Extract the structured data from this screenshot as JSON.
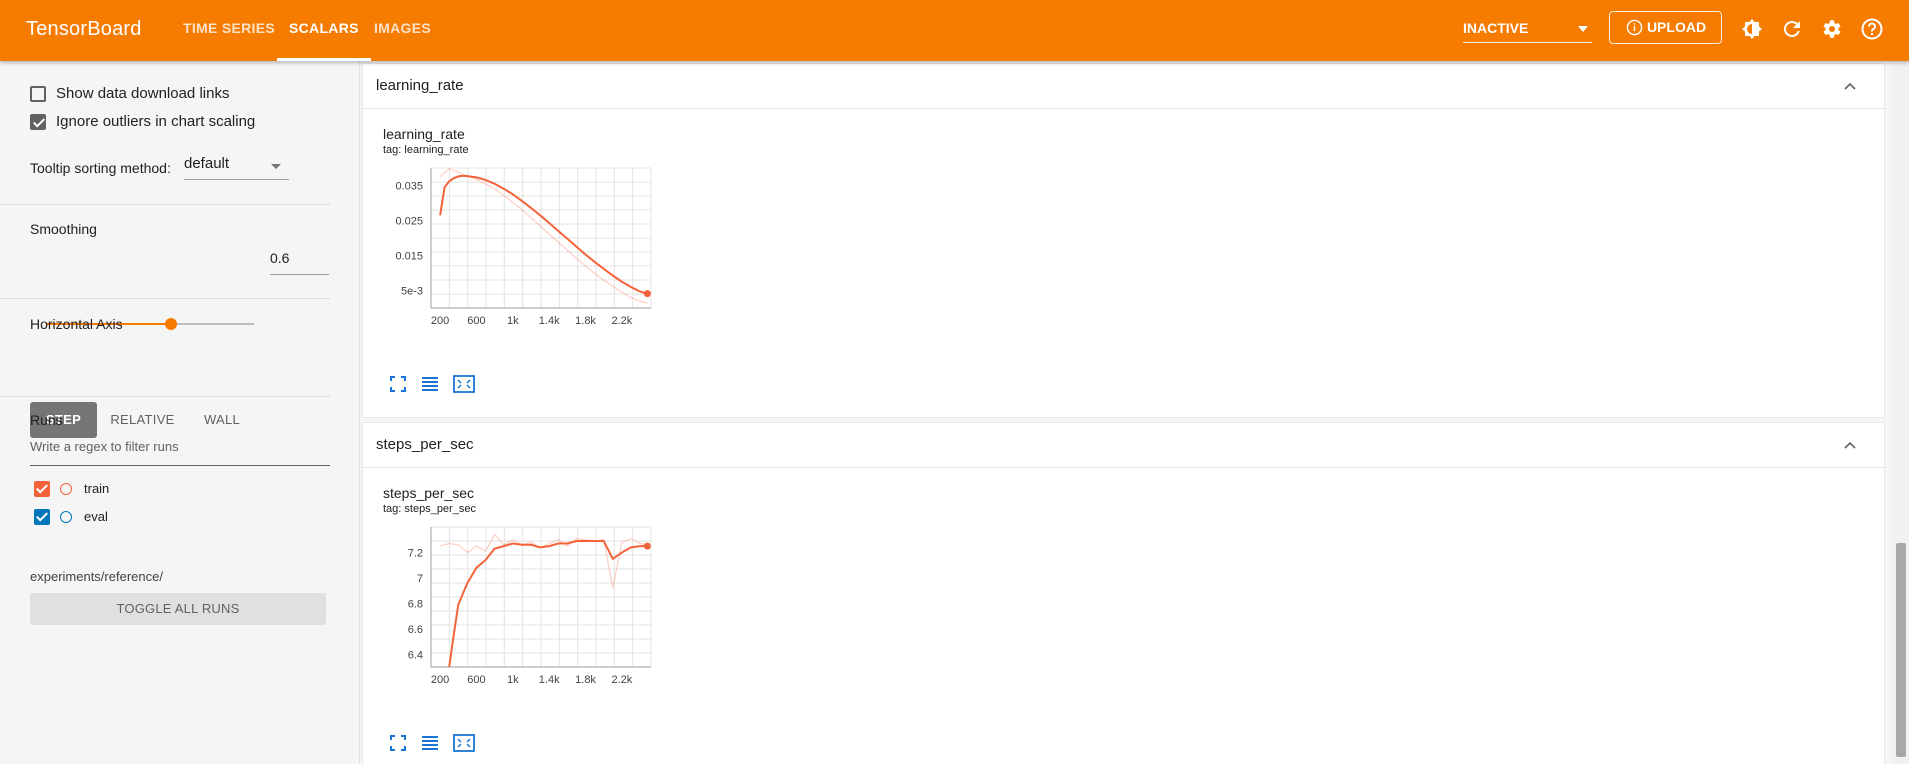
{
  "app": {
    "title": "TensorBoard",
    "tabs": [
      {
        "label": "TIME SERIES",
        "active": false
      },
      {
        "label": "SCALARS",
        "active": true
      },
      {
        "label": "IMAGES",
        "active": false
      }
    ],
    "run_status": "INACTIVE",
    "upload_label": "UPLOAD",
    "icons": [
      "brightness-icon",
      "refresh-icon",
      "settings-icon",
      "help-icon"
    ],
    "accent_color": "#f57c00"
  },
  "sidebar": {
    "show_download_links": {
      "label": "Show data download links",
      "checked": false
    },
    "ignore_outliers": {
      "label": "Ignore outliers in chart scaling",
      "checked": true
    },
    "tooltip_sorting": {
      "label": "Tooltip sorting method:",
      "value": "default"
    },
    "smoothing": {
      "label": "Smoothing",
      "value": "0.6",
      "fraction": 0.6
    },
    "horizontal_axis": {
      "label": "Horizontal Axis",
      "options": [
        {
          "label": "STEP",
          "active": true
        },
        {
          "label": "RELATIVE",
          "active": false
        },
        {
          "label": "WALL",
          "active": false
        }
      ]
    },
    "runs": {
      "label": "Runs",
      "filter_placeholder": "Write a regex to filter runs",
      "items": [
        {
          "label": "train",
          "checked": true,
          "color": "#f4623a"
        },
        {
          "label": "eval",
          "checked": true,
          "color": "#0077bb"
        }
      ],
      "toggle_label": "TOGGLE ALL RUNS",
      "path": "experiments/reference/"
    }
  },
  "cards": [
    {
      "group_title": "learning_rate",
      "chart_title": "learning_rate",
      "tag": "tag: learning_rate"
    },
    {
      "group_title": "steps_per_sec",
      "chart_title": "steps_per_sec",
      "tag": "tag: steps_per_sec"
    }
  ],
  "chart_data": [
    {
      "type": "line",
      "title": "learning_rate",
      "subtitle": "tag: learning_rate",
      "xlabel": "",
      "ylabel": "",
      "xlim": [
        100,
        2520
      ],
      "ylim": [
        0.0,
        0.04
      ],
      "x_ticks": [
        200,
        600,
        1000,
        1400,
        1800,
        2200
      ],
      "x_tick_labels": [
        "200",
        "600",
        "1k",
        "1.4k",
        "1.8k",
        "2.2k"
      ],
      "y_ticks": [
        0.005,
        0.015,
        0.025,
        0.035
      ],
      "y_tick_labels": [
        "5e-3",
        "0.015",
        "0.025",
        "0.035"
      ],
      "grid": true,
      "series": [
        {
          "name": "train",
          "color": "#f4623a",
          "raw": [
            [
              200,
              0.0375
            ],
            [
              300,
              0.0398
            ],
            [
              400,
              0.0388
            ],
            [
              500,
              0.0377
            ],
            [
              600,
              0.0367
            ],
            [
              700,
              0.0355
            ],
            [
              800,
              0.034
            ],
            [
              900,
              0.0322
            ],
            [
              1000,
              0.0302
            ],
            [
              1100,
              0.0281
            ],
            [
              1200,
              0.0258
            ],
            [
              1300,
              0.0235
            ],
            [
              1400,
              0.0211
            ],
            [
              1500,
              0.0188
            ],
            [
              1600,
              0.0165
            ],
            [
              1700,
              0.0142
            ],
            [
              1800,
              0.012
            ],
            [
              1900,
              0.0099
            ],
            [
              2000,
              0.008
            ],
            [
              2100,
              0.0062
            ],
            [
              2200,
              0.0045
            ],
            [
              2300,
              0.003
            ],
            [
              2400,
              0.0019
            ],
            [
              2480,
              0.0014
            ]
          ],
          "smoothed": [
            [
              200,
              0.0265
            ],
            [
              250,
              0.0345
            ],
            [
              300,
              0.0362
            ],
            [
              350,
              0.0371
            ],
            [
              400,
              0.0376
            ],
            [
              450,
              0.0378
            ],
            [
              500,
              0.0377
            ],
            [
              600,
              0.0373
            ],
            [
              700,
              0.0366
            ],
            [
              800,
              0.0355
            ],
            [
              900,
              0.0341
            ],
            [
              1000,
              0.0325
            ],
            [
              1100,
              0.0306
            ],
            [
              1200,
              0.0286
            ],
            [
              1300,
              0.0265
            ],
            [
              1400,
              0.0243
            ],
            [
              1500,
              0.022
            ],
            [
              1600,
              0.0198
            ],
            [
              1700,
              0.0175
            ],
            [
              1800,
              0.0153
            ],
            [
              1900,
              0.0132
            ],
            [
              2000,
              0.0112
            ],
            [
              2100,
              0.0093
            ],
            [
              2200,
              0.0075
            ],
            [
              2300,
              0.006
            ],
            [
              2400,
              0.0047
            ],
            [
              2480,
              0.0041
            ]
          ]
        }
      ]
    },
    {
      "type": "line",
      "title": "steps_per_sec",
      "subtitle": "tag: steps_per_sec",
      "xlabel": "",
      "ylabel": "",
      "xlim": [
        100,
        2520
      ],
      "ylim": [
        6.3,
        7.4
      ],
      "x_ticks": [
        200,
        600,
        1000,
        1400,
        1800,
        2200
      ],
      "x_tick_labels": [
        "200",
        "600",
        "1k",
        "1.4k",
        "1.8k",
        "2.2k"
      ],
      "y_ticks": [
        6.4,
        6.6,
        6.8,
        7.0,
        7.2
      ],
      "y_tick_labels": [
        "6.4",
        "6.6",
        "6.8",
        "7",
        "7.2"
      ],
      "grid": true,
      "series": [
        {
          "name": "train",
          "color": "#f4623a",
          "raw": [
            [
              200,
              7.25
            ],
            [
              300,
              7.27
            ],
            [
              400,
              7.26
            ],
            [
              500,
              7.2
            ],
            [
              600,
              7.25
            ],
            [
              700,
              7.21
            ],
            [
              800,
              7.34
            ],
            [
              900,
              7.26
            ],
            [
              1000,
              7.3
            ],
            [
              1100,
              7.26
            ],
            [
              1200,
              7.28
            ],
            [
              1300,
              7.24
            ],
            [
              1400,
              7.27
            ],
            [
              1500,
              7.3
            ],
            [
              1600,
              7.25
            ],
            [
              1700,
              7.31
            ],
            [
              1800,
              7.3
            ],
            [
              1900,
              7.29
            ],
            [
              2000,
              7.3
            ],
            [
              2100,
              6.92
            ],
            [
              2200,
              7.28
            ],
            [
              2300,
              7.31
            ],
            [
              2400,
              7.27
            ],
            [
              2480,
              7.26
            ]
          ],
          "smoothed": [
            [
              300,
              6.3
            ],
            [
              350,
              6.55
            ],
            [
              400,
              6.79
            ],
            [
              500,
              6.96
            ],
            [
              600,
              7.08
            ],
            [
              700,
              7.14
            ],
            [
              800,
              7.23
            ],
            [
              900,
              7.25
            ],
            [
              1000,
              7.27
            ],
            [
              1100,
              7.26
            ],
            [
              1200,
              7.26
            ],
            [
              1300,
              7.24
            ],
            [
              1400,
              7.25
            ],
            [
              1500,
              7.27
            ],
            [
              1600,
              7.27
            ],
            [
              1700,
              7.29
            ],
            [
              1800,
              7.29
            ],
            [
              1900,
              7.29
            ],
            [
              2000,
              7.29
            ],
            [
              2100,
              7.15
            ],
            [
              2200,
              7.2
            ],
            [
              2300,
              7.24
            ],
            [
              2400,
              7.25
            ],
            [
              2480,
              7.25
            ]
          ]
        }
      ]
    }
  ]
}
